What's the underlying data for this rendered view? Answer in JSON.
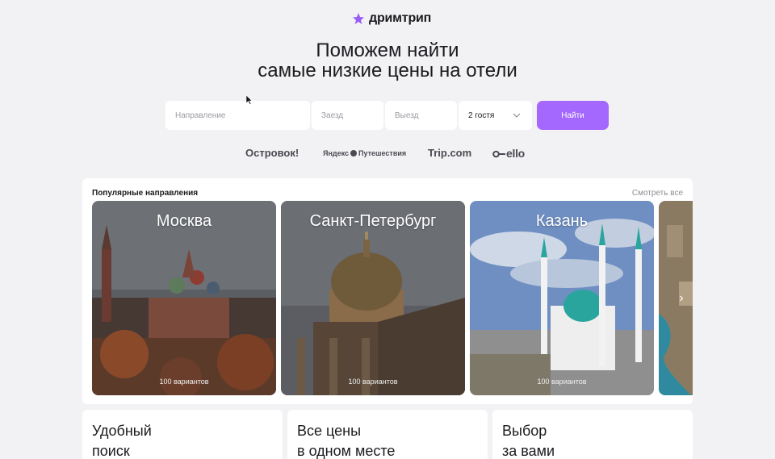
{
  "brand": {
    "name": "дримтрип",
    "accent": "#a468ff"
  },
  "hero": {
    "line1": "Поможем найти",
    "line2": "самые низкие цены на отели"
  },
  "search": {
    "destination_placeholder": "Направление",
    "checkin_placeholder": "Заезд",
    "checkout_placeholder": "Выезд",
    "guests_value": "2 гостя",
    "submit_label": "Найти"
  },
  "partners": {
    "ostrovok": "Островок!",
    "yandex": "Яндекс",
    "yandex_suffix": "Путешествия",
    "trip": "Trip.com",
    "otello": "ello"
  },
  "popular": {
    "title": "Популярные направления",
    "see_all": "Смотреть все",
    "cards": [
      {
        "city": "Москва",
        "count": "100 вариантов"
      },
      {
        "city": "Санкт-Петербург",
        "count": "100 вариантов"
      },
      {
        "city": "Казань",
        "count": "100 вариантов"
      }
    ]
  },
  "features": [
    {
      "line1": "Удобный",
      "line2": "поиск"
    },
    {
      "line1": "Все цены",
      "line2": "в одном месте"
    },
    {
      "line1": "Выбор",
      "line2": "за вами"
    }
  ]
}
